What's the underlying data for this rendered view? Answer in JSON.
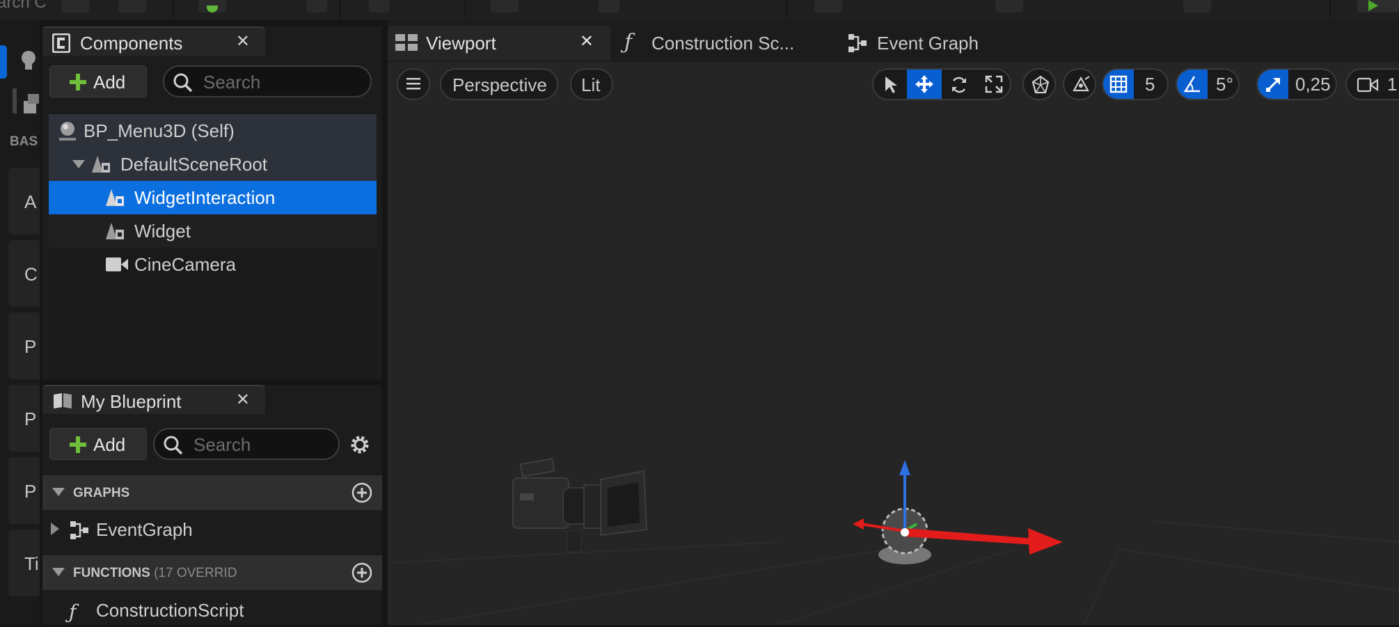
{
  "toolbar": {
    "search_fragment": "arch C"
  },
  "left_strip": {
    "category_label": "BAS",
    "categories": [
      "A",
      "C",
      "P",
      "P",
      "P",
      "Ti"
    ]
  },
  "components_panel": {
    "tab_title": "Components",
    "add_label": "Add",
    "search_placeholder": "Search",
    "tree": [
      {
        "label": "BP_Menu3D (Self)",
        "icon": "actor-icon"
      },
      {
        "label": "DefaultSceneRoot",
        "icon": "scene-component-icon"
      },
      {
        "label": "WidgetInteraction",
        "icon": "scene-component-icon",
        "selected": true
      },
      {
        "label": "Widget",
        "icon": "scene-component-icon"
      },
      {
        "label": "CineCamera",
        "icon": "camera-icon"
      }
    ]
  },
  "my_blueprint": {
    "tab_title": "My Blueprint",
    "add_label": "Add",
    "search_placeholder": "Search",
    "graphs_header": "GRAPHS",
    "graph_items": [
      "EventGraph"
    ],
    "functions_header": "FUNCTIONS",
    "functions_override": "(17 OVERRID",
    "function_items": [
      "ConstructionScript"
    ]
  },
  "editor_tabs": {
    "viewport": "Viewport",
    "construction": "Construction Sc...",
    "event_graph": "Event Graph"
  },
  "viewport_toolbar": {
    "perspective": "Perspective",
    "lit": "Lit",
    "grid_snap": "5",
    "rotation_snap": "5°",
    "scale_snap": "0,25",
    "camera_speed": "1"
  },
  "colors": {
    "accent_blue": "#0a66d6",
    "selection": "#0b6fe0",
    "add_green": "#6fbf3a",
    "gizmo_red": "#e21b1b",
    "gizmo_blue": "#2f6fe0",
    "gizmo_green": "#3cb43c"
  }
}
